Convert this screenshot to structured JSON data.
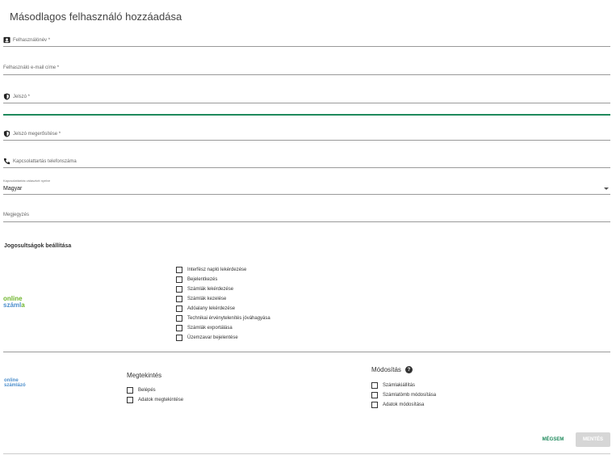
{
  "title": "Másodlagos felhasználó hozzáadása",
  "fields": {
    "username": {
      "label": "Felhasználónév *",
      "icon": "person-badge-icon"
    },
    "email": {
      "label": "Felhasználó e-mail címe *"
    },
    "password": {
      "label": "Jelszó *",
      "icon": "shield-icon"
    },
    "password_confirm": {
      "label": "Jelszó megerősítése *",
      "icon": "shield-icon"
    },
    "phone": {
      "label": "Kapcsolattartás telefonszáma",
      "icon": "phone-icon"
    },
    "language": {
      "label": "Kapcsolattartás választott nyelve",
      "value": "Magyar"
    },
    "note": {
      "label": "Megjegyzés"
    }
  },
  "permissions": {
    "title": "Jogosultságok beállítása",
    "online_szamla": {
      "logo_line1": "online",
      "logo_line2": "száml",
      "logo_accent": "a",
      "items": [
        "Interfész napló lekérdezése",
        "Bejelentkezés",
        "Számlák lekérdezése",
        "Számlák kezelése",
        "Adóalany lekérdezése",
        "Technikai érvénytelenítés jóváhagyása",
        "Számlák exportálása",
        "Üzemzavar bejelentése"
      ]
    },
    "online_szamlazo": {
      "logo_line1": "online",
      "logo_line2": "számlázó",
      "view": {
        "title": "Megtekintés",
        "items": [
          "Belépés",
          "Adatok megtekintése"
        ]
      },
      "modify": {
        "title": "Módosítás",
        "help_icon": "help-icon",
        "help_glyph": "?",
        "items": [
          "Számlakiállítás",
          "Számlatömb módosítása",
          "Adatok módosítása"
        ]
      }
    }
  },
  "buttons": {
    "cancel": "MÉGSEM",
    "save": "MENTÉS"
  },
  "colors": {
    "accent": "#1f8a5c",
    "disabled": "#d6d6d6"
  }
}
